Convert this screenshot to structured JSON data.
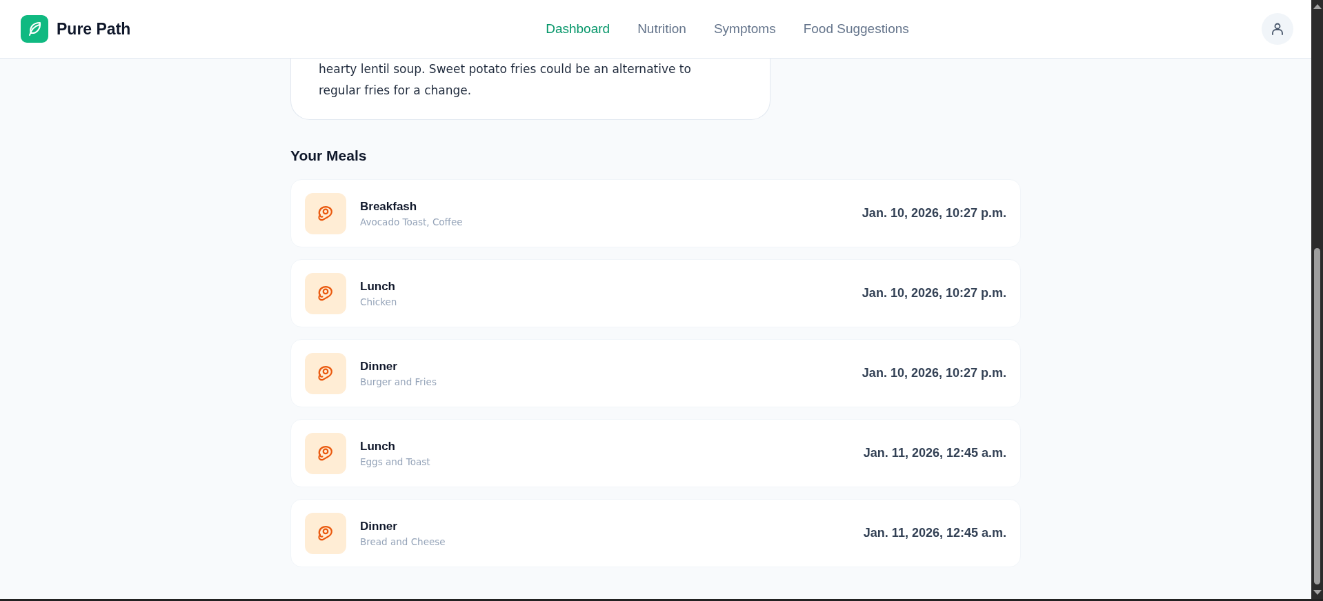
{
  "header": {
    "brand": "Pure Path",
    "nav": [
      {
        "label": "Dashboard",
        "selected": true
      },
      {
        "label": "Nutrition",
        "selected": false
      },
      {
        "label": "Symptoms",
        "selected": false
      },
      {
        "label": "Food Suggestions",
        "selected": false
      }
    ]
  },
  "suggestion_card": {
    "text_lines": [
      "hearty lentil soup. Sweet potato fries could be an alternative to",
      "regular fries for a change."
    ]
  },
  "meals": {
    "title": "Your Meals",
    "items": [
      {
        "name": "Breakfash",
        "foods": "Avocado Toast, Coffee",
        "time": "Jan. 10, 2026, 10:27 p.m."
      },
      {
        "name": "Lunch",
        "foods": "Chicken",
        "time": "Jan. 10, 2026, 10:27 p.m."
      },
      {
        "name": "Dinner",
        "foods": "Burger and Fries",
        "time": "Jan. 10, 2026, 10:27 p.m."
      },
      {
        "name": "Lunch",
        "foods": "Eggs and Toast",
        "time": "Jan. 11, 2026, 12:45 a.m."
      },
      {
        "name": "Dinner",
        "foods": "Bread and Cheese",
        "time": "Jan. 11, 2026, 12:45 a.m."
      }
    ]
  }
}
